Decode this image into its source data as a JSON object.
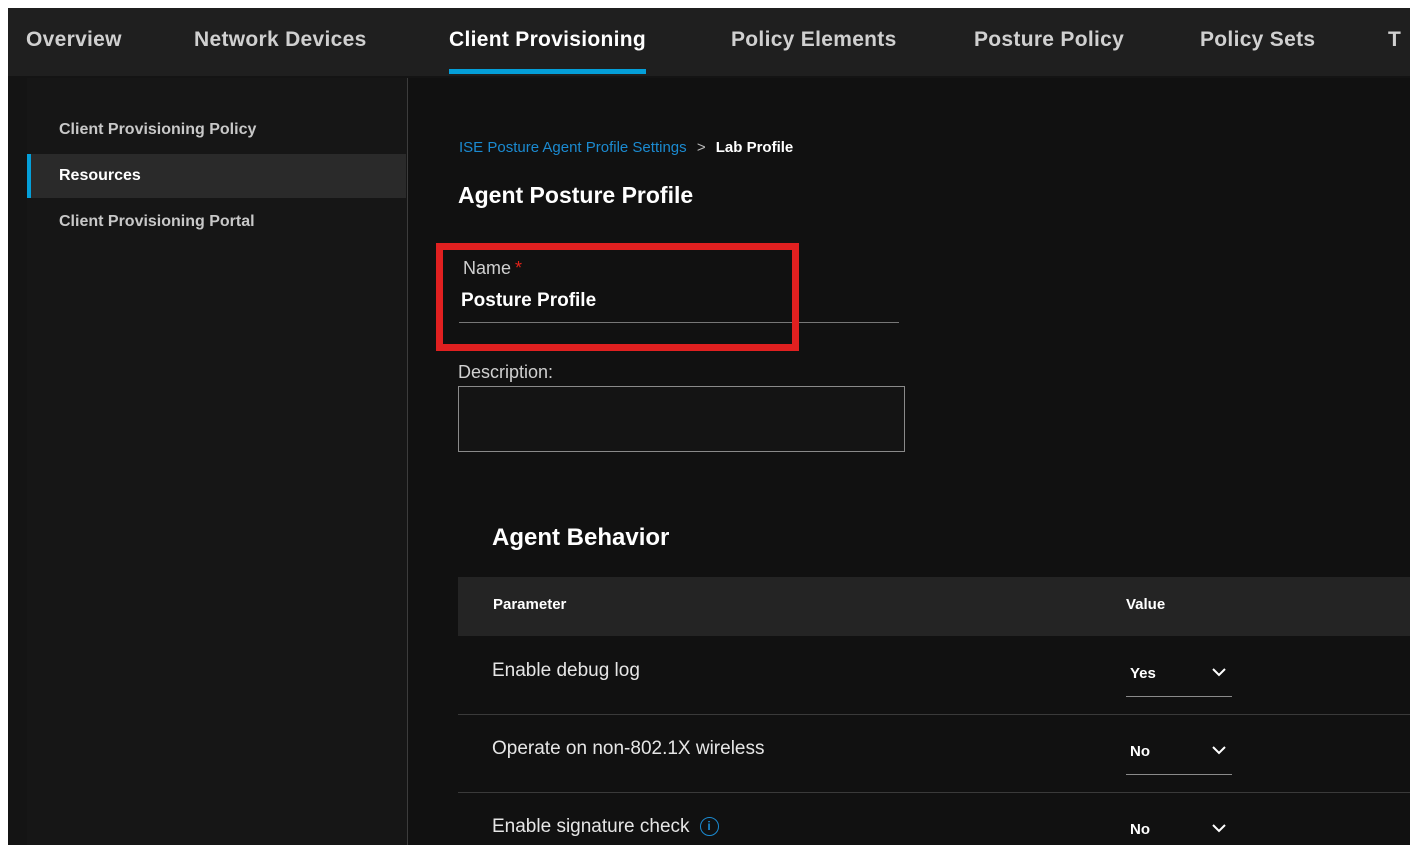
{
  "topnav": {
    "tabs": [
      {
        "label": "Overview"
      },
      {
        "label": "Network Devices"
      },
      {
        "label": "Client Provisioning",
        "active": true
      },
      {
        "label": "Policy Elements"
      },
      {
        "label": "Posture Policy"
      },
      {
        "label": "Policy Sets"
      },
      {
        "label": "T"
      }
    ]
  },
  "sidebar": {
    "items": [
      {
        "label": "Client Provisioning Policy"
      },
      {
        "label": "Resources",
        "active": true
      },
      {
        "label": "Client Provisioning Portal"
      }
    ]
  },
  "breadcrumb": {
    "parent": "ISE Posture Agent Profile Settings",
    "separator": ">",
    "current": "Lab Profile"
  },
  "form": {
    "title": "Agent Posture Profile",
    "name_label": "Name",
    "required_mark": "*",
    "name_value": "Posture Profile",
    "description_label": "Description:",
    "description_value": ""
  },
  "behavior": {
    "title": "Agent Behavior",
    "columns": {
      "parameter": "Parameter",
      "value": "Value"
    },
    "rows": [
      {
        "parameter": "Enable debug log",
        "value": "Yes",
        "info": false
      },
      {
        "parameter": "Operate on non-802.1X wireless",
        "value": "No",
        "info": false
      },
      {
        "parameter": "Enable signature check",
        "value": "No",
        "info": true
      }
    ]
  },
  "colors": {
    "accent": "#049fd9",
    "link": "#1b8ad0",
    "highlight": "#e02020",
    "required": "#e2231a"
  },
  "icons": {
    "info": "info-circle-icon",
    "chevron": "chevron-down-icon",
    "breadcrumb_separator": "chevron-right-icon"
  }
}
